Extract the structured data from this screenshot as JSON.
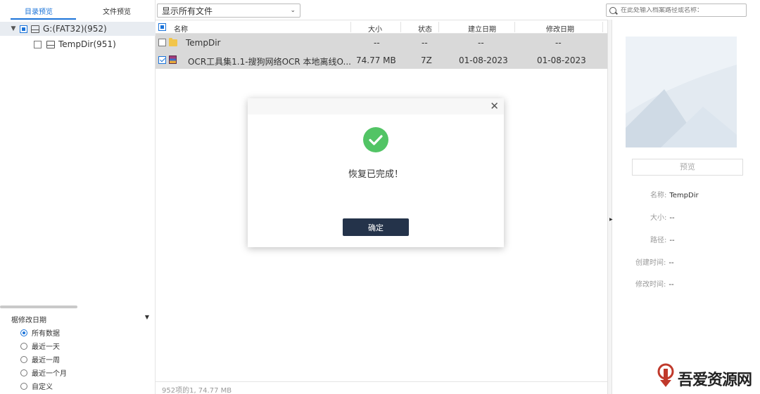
{
  "left_tabs": {
    "directory_preview": "目录预览",
    "file_preview": "文件预览"
  },
  "tree": {
    "root": {
      "label": "G:(FAT32)(952)"
    },
    "child": {
      "label": "TempDir(951)"
    }
  },
  "filter": {
    "title": "椐修改日期",
    "options": [
      "所有数据",
      "最近一天",
      "最近一周",
      "最近一个月",
      "自定义"
    ],
    "selected_index": 0
  },
  "file_filter": {
    "selected": "显示所有文件"
  },
  "table": {
    "columns": {
      "name": "名称",
      "size": "大小",
      "status": "状态",
      "created": "建立日期",
      "modified": "修改日期"
    },
    "rows": [
      {
        "name": "TempDir",
        "size": "--",
        "status": "--",
        "created": "--",
        "modified": "--",
        "icon": "folder-icon",
        "checked": false
      },
      {
        "name": "OCR工具集1.1-搜狗网络OCR 本地离线O...",
        "size": "74.77  MB",
        "status": "7Z",
        "created": "01-08-2023",
        "modified": "01-08-2023",
        "icon": "rar-archive-icon",
        "checked": true
      }
    ]
  },
  "status_bar": {
    "text": "952项的1, 74.77  MB"
  },
  "search": {
    "placeholder": "在此处输入档案路径或名称："
  },
  "details": {
    "preview_button": "预览",
    "name_label": "名称:",
    "name_value": "TempDir",
    "size_label": "大小:",
    "size_value": "--",
    "path_label": "路径:",
    "path_value": "--",
    "created_label": "创建时间:",
    "created_value": "--",
    "modified_label": "修改时间:",
    "modified_value": "--"
  },
  "dialog": {
    "message": "恢复已完成！",
    "ok_label": "确定"
  },
  "watermark": {
    "text": "吾爱资源网"
  },
  "colors": {
    "accent": "#1a73d9",
    "success": "#52c465",
    "button_dark": "#24334a",
    "row_highlight": "#d9d9d9"
  }
}
